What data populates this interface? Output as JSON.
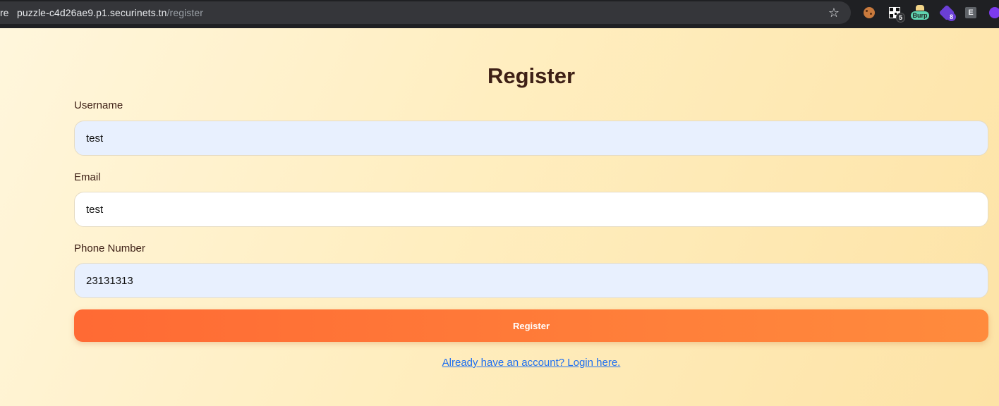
{
  "browser": {
    "scheme_fragment": "re",
    "url_host": "puzzle-c4d26ae9.p1.securinets.tn",
    "url_path": "/register",
    "extensions": [
      {
        "name": "cookie-editor-icon"
      },
      {
        "name": "qr-code-icon",
        "badge": "5"
      },
      {
        "name": "burp-icon",
        "label": "Burp"
      },
      {
        "name": "shard-icon",
        "badge": "8"
      },
      {
        "name": "e-extension-icon",
        "label": "E"
      }
    ]
  },
  "form": {
    "title": "Register",
    "username_label": "Username",
    "username_value": "test",
    "email_label": "Email",
    "email_value": "test",
    "phone_label": "Phone Number",
    "phone_value": "23131313",
    "submit_label": "Register",
    "login_link": "Already have an account? Login here."
  },
  "colors": {
    "accent": "#ff7033",
    "title": "#3e2016",
    "link": "#1e6ff0",
    "autofill_bg": "#e8f0fe"
  }
}
